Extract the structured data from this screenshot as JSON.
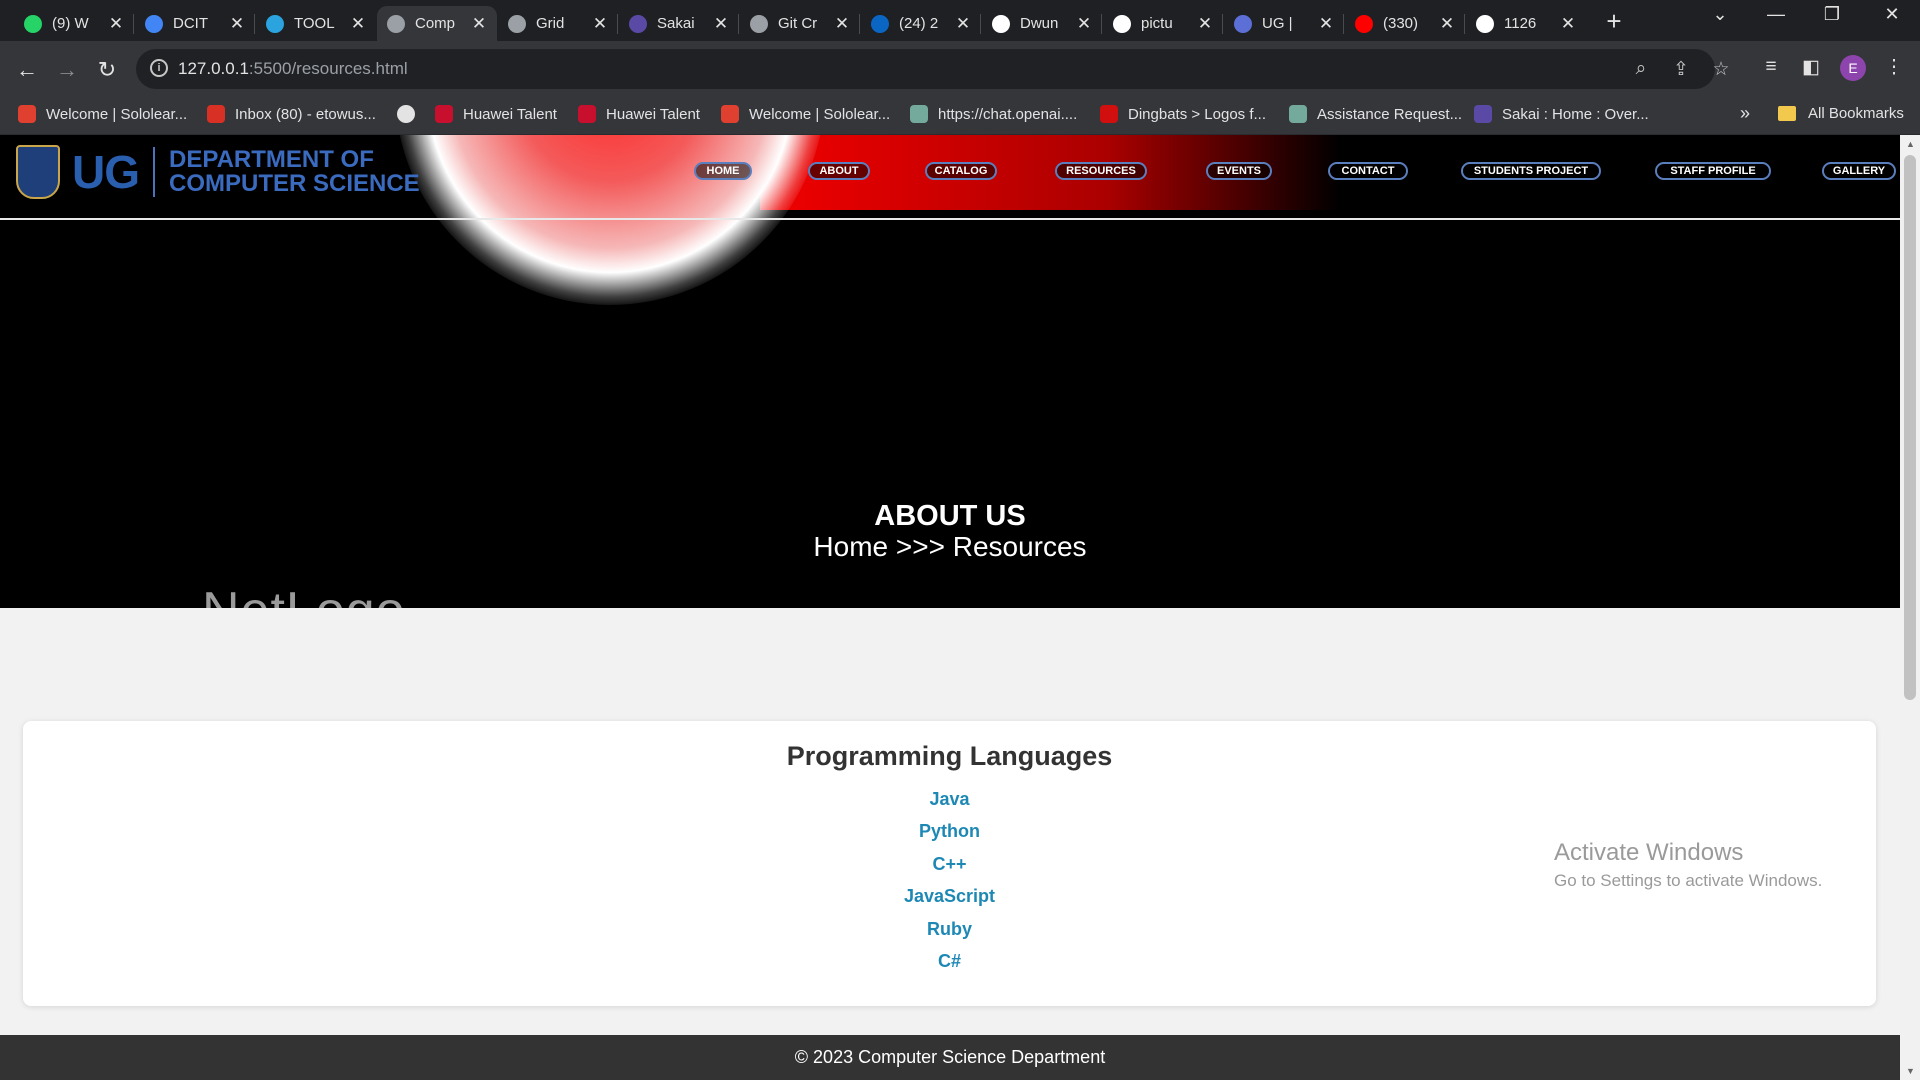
{
  "browser": {
    "tabs": [
      {
        "label": "(9) W",
        "icon": "whatsapp-icon",
        "color": "#25d366"
      },
      {
        "label": "DCIT",
        "icon": "docs-icon",
        "color": "#4285f4"
      },
      {
        "label": "TOOL",
        "icon": "telegram-icon",
        "color": "#2aa3df"
      },
      {
        "label": "Comp",
        "icon": "globe-icon",
        "color": "#9aa0a6"
      },
      {
        "label": "Grid",
        "icon": "openai-icon",
        "color": "#9aa0a6"
      },
      {
        "label": "Sakai",
        "icon": "sakai-icon",
        "color": "#5a4aa5"
      },
      {
        "label": "Git Cr",
        "icon": "globe-icon",
        "color": "#9aa0a6"
      },
      {
        "label": "(24) 2",
        "icon": "linkedin-icon",
        "color": "#0a66c2"
      },
      {
        "label": "Dwun",
        "icon": "google-icon",
        "color": "#ffffff"
      },
      {
        "label": "pictu",
        "icon": "google-icon",
        "color": "#ffffff"
      },
      {
        "label": "UG |",
        "icon": "ug-icon",
        "color": "#5b6fd6"
      },
      {
        "label": "(330)",
        "icon": "youtube-icon",
        "color": "#ff0000"
      },
      {
        "label": "1126",
        "icon": "github-icon",
        "color": "#ffffff"
      }
    ],
    "url_host": "127.0.0.1",
    "url_path": ":5500/resources.html",
    "profile_initial": "E",
    "bookmarks": [
      {
        "label": "Welcome | Sololear...",
        "color": "#e0402f"
      },
      {
        "label": "Inbox (80) - etowus...",
        "color": "#d93025"
      },
      {
        "label": "",
        "color": "#e3e3e3"
      },
      {
        "label": "Huawei Talent",
        "color": "#c8102e"
      },
      {
        "label": "Huawei Talent",
        "color": "#c8102e"
      },
      {
        "label": "Welcome | Sololear...",
        "color": "#e0402f"
      },
      {
        "label": "https://chat.openai....",
        "color": "#74aa9c"
      },
      {
        "label": "Dingbats > Logos f...",
        "color": "#d10f0f"
      },
      {
        "label": "Assistance Request...",
        "color": "#74aa9c"
      },
      {
        "label": "Sakai : Home : Over...",
        "color": "#5a4aa5"
      }
    ],
    "all_bookmarks": "All Bookmarks",
    "more": "»"
  },
  "site": {
    "logo_text": "UG",
    "dept_line1": "DEPARTMENT OF",
    "dept_line2": "COMPUTER SCIENCE",
    "nav": [
      "HOME",
      "ABOUT",
      "CATALOG",
      "RESOURCES",
      "EVENTS",
      "CONTACT",
      "STUDENTS PROJECT",
      "STAFF PROFILE",
      "GALLERY"
    ],
    "hero_title": "ABOUT US",
    "hero_breadcrumb": "Home >>> Resources",
    "hero_logo": "NetLogo"
  },
  "card": {
    "title": "Programming Languages",
    "languages": [
      "Java",
      "Python",
      "C++",
      "JavaScript",
      "Ruby",
      "C#"
    ]
  },
  "watermark": {
    "line1": "Activate Windows",
    "line2": "Go to Settings to activate Windows."
  },
  "footer": {
    "text": "© 2023 Computer Science Department"
  }
}
